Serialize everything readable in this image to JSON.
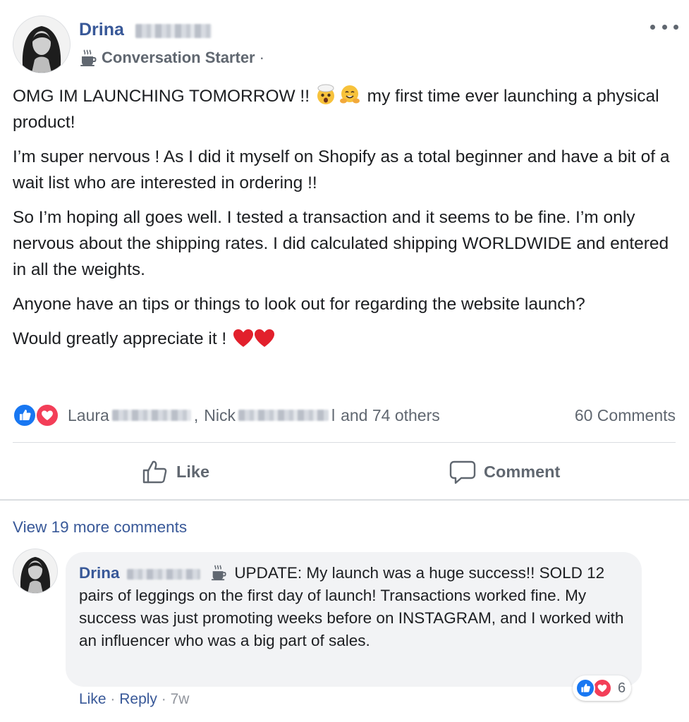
{
  "post": {
    "author_first": "Drina",
    "badge_label": "Conversation Starter",
    "badge_separator": "·",
    "body": {
      "p1_a": "OMG IM LAUNCHING TOMORROW !!",
      "p1_b": "my first time ever launching a physical product!",
      "p2": "I’m super nervous ! As I did it myself on Shopify as a total beginner and have a bit of a wait list who are interested in ordering !!",
      "p3": "So I’m hoping all goes well. I tested a transaction and it seems to be fine. I’m only nervous about the shipping rates. I did calculated shipping WORLDWIDE and entered in all the weights.",
      "p4": "Anyone have an tips or things to look out for regarding the website launch?",
      "p5": "Would greatly appreciate it !"
    },
    "icons": [
      "mug-icon",
      "exploding-head-emoji",
      "hugging-face-emoji",
      "red-heart-emoji",
      "more-options-icon"
    ]
  },
  "reactions": {
    "name1": "Laura",
    "separator": ",",
    "name2": "Nick",
    "name2_tail": "l",
    "others": "and 74 others",
    "comments_count": "60 Comments",
    "icons": [
      "like-reaction-icon",
      "love-reaction-icon"
    ]
  },
  "actions": {
    "like_label": "Like",
    "comment_label": "Comment",
    "icons": [
      "thumbs-up-icon",
      "speech-bubble-icon"
    ]
  },
  "comments": {
    "view_more": "View 19 more comments",
    "item": {
      "author_first": "Drina",
      "text_start": "UPDATE: My launch was a huge success!!",
      "text_rest": "SOLD 12 pairs of leggings on the first day of launch! Transactions worked fine. My success was just promoting weeks before on INSTAGRAM, and I worked with an influencer who was a big part of sales.",
      "reaction_count": "6",
      "like_label": "Like",
      "reply_label": "Reply",
      "separator": "·",
      "age": "7w"
    }
  },
  "colors": {
    "link_blue": "#385898",
    "muted_gray": "#606770",
    "like_blue": "#1877f2",
    "love_red": "#f33e58",
    "bubble_bg": "#f2f3f5"
  }
}
